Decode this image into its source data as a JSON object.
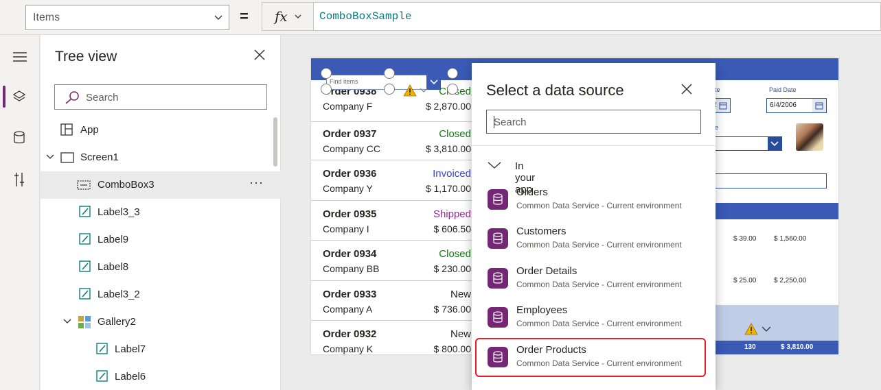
{
  "formula_bar": {
    "property": "Items",
    "equals": "=",
    "fx_label": "fx",
    "formula": "ComboBoxSample"
  },
  "rail": {
    "items": [
      {
        "icon": "hamburger-icon"
      },
      {
        "icon": "layers-icon",
        "selected": true
      },
      {
        "icon": "database-icon"
      },
      {
        "icon": "tools-icon"
      }
    ]
  },
  "tree_view": {
    "title": "Tree view",
    "search_placeholder": "Search",
    "items": [
      {
        "label": "App",
        "icon": "app-icon",
        "level": 0
      },
      {
        "label": "Screen1",
        "icon": "screen-icon",
        "level": 0,
        "expanded": true
      },
      {
        "label": "ComboBox3",
        "icon": "combobox-icon",
        "level": 1,
        "selected": true,
        "more": "···"
      },
      {
        "label": "Label3_3",
        "icon": "label-icon",
        "level": 1
      },
      {
        "label": "Label9",
        "icon": "label-icon",
        "level": 1
      },
      {
        "label": "Label8",
        "icon": "label-icon",
        "level": 1
      },
      {
        "label": "Label3_2",
        "icon": "label-icon",
        "level": 1
      },
      {
        "label": "Gallery2",
        "icon": "gallery-icon",
        "level": 1,
        "expanded": true
      },
      {
        "label": "Label7",
        "icon": "label-icon",
        "level": 2
      },
      {
        "label": "Label6",
        "icon": "label-icon",
        "level": 2
      }
    ]
  },
  "canvas": {
    "combobox_placeholder": "Find items",
    "orders": [
      {
        "order": "Order 0938",
        "company": "Company F",
        "status": "Closed",
        "amount": "$ 2,870.00",
        "status_color": "#107c10"
      },
      {
        "order": "Order 0937",
        "company": "Company CC",
        "status": "Closed",
        "amount": "$ 3,810.00",
        "status_color": "#107c10"
      },
      {
        "order": "Order 0936",
        "company": "Company Y",
        "status": "Invoiced",
        "amount": "$ 1,170.00",
        "status_color": "#3a45d6"
      },
      {
        "order": "Order 0935",
        "company": "Company I",
        "status": "Shipped",
        "amount": "$ 606.50",
        "status_color": "#8f2c8f"
      },
      {
        "order": "Order 0934",
        "company": "Company BB",
        "status": "Closed",
        "amount": "$ 230.00",
        "status_color": "#107c10"
      },
      {
        "order": "Order 0933",
        "company": "Company A",
        "status": "New",
        "amount": "$ 736.00",
        "status_color": "#252423"
      },
      {
        "order": "Order 0932",
        "company": "Company K",
        "status": "New",
        "amount": "$ 800.00",
        "status_color": "#252423"
      }
    ],
    "right": {
      "date_label": "te",
      "paid_date_label": "Paid Date",
      "paid_date_value": "6/4/2006",
      "partial_date": "5",
      "partial_label": "e",
      "row1_price": "$ 39.00",
      "row1_total": "$ 1,560.00",
      "row2_price": "$ 25.00",
      "row2_total": "$ 2,250.00",
      "footer_qty": "130",
      "footer_total": "$ 3,810.00"
    }
  },
  "dialog": {
    "title": "Select a data source",
    "search_placeholder": "Search",
    "section": "In your app",
    "sources": [
      {
        "name": "Orders",
        "desc": "Common Data Service - Current environment"
      },
      {
        "name": "Customers",
        "desc": "Common Data Service - Current environment"
      },
      {
        "name": "Order Details",
        "desc": "Common Data Service - Current environment"
      },
      {
        "name": "Employees",
        "desc": "Common Data Service - Current environment"
      },
      {
        "name": "Order Products",
        "desc": "Common Data Service - Current environment",
        "highlighted": true
      }
    ],
    "highlight_color": "#e0202a",
    "accent": "#742774"
  }
}
